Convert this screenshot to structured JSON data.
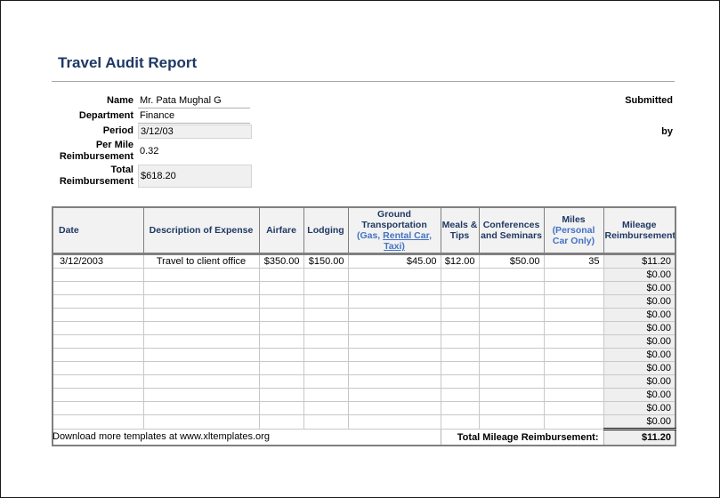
{
  "page": {
    "title": "Travel Audit Report",
    "footer": "Download more templates at www.xltemplates.org"
  },
  "form": {
    "fields": [
      {
        "label": "Name",
        "value": "Mr. Pata Mughal G"
      },
      {
        "label": "Department",
        "value": "Finance"
      },
      {
        "label": "Period",
        "value": "3/12/03"
      },
      {
        "label": "Per Mile Reimbursement",
        "value": "0.32"
      },
      {
        "label": "Total Reimbursement",
        "value": "$618.20"
      }
    ],
    "submitted_label": "Submitted",
    "by_label": "by"
  },
  "colors": {
    "heading_navy": "#1F3864",
    "note_blue": "#4472C4",
    "header_fill": "#F2F2F2",
    "shaded_fill": "#EFEFEF",
    "table_border": "#7F7F7F"
  },
  "table": {
    "columns": [
      {
        "label": "Date"
      },
      {
        "label": "Description of Expense"
      },
      {
        "label": "Airfare"
      },
      {
        "label": "Lodging"
      },
      {
        "label": "Ground Transportation",
        "note1": " (Gas, ",
        "note2": "Rental Car, Taxi)"
      },
      {
        "label": "Meals & Tips"
      },
      {
        "label": "Conferences and Seminars"
      },
      {
        "label": "Miles",
        "note1": " (Personal Car Only)",
        "note2": ""
      },
      {
        "label": "Mileage Reimbursement"
      }
    ],
    "data_row": [
      "3/12/2003",
      "Travel to client office",
      "$350.00",
      "$150.00",
      "$45.00",
      "$12.00",
      "$50.00",
      "35",
      "$11.20"
    ],
    "empty_rows_count": 12,
    "empty_value": "$0.00",
    "total": {
      "label": "Total Mileage Reimbursement:",
      "value": "$11.20"
    }
  }
}
